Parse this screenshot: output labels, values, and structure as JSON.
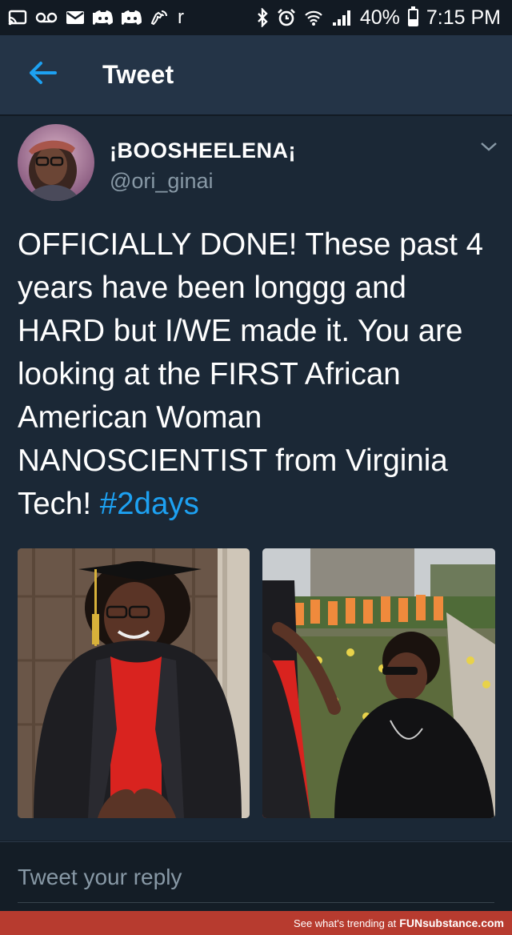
{
  "status_bar": {
    "carrier_glyph": "r",
    "battery_percent": "40%",
    "battery_level": 0.4,
    "time": "7:15 PM",
    "icons": [
      "cast-icon",
      "voicemail-icon",
      "mail-icon",
      "discord-icon",
      "discord-icon",
      "wifi-calling-icon",
      "bluetooth-icon",
      "alarm-icon",
      "wifi-icon",
      "signal-icon",
      "battery-icon"
    ]
  },
  "app_bar": {
    "back_icon": "arrow-left-icon",
    "title": "Tweet"
  },
  "tweet": {
    "display_name": "¡BOOSHEELENA¡",
    "handle": "@ori_ginai",
    "text": "OFFICIALLY DONE! These past 4 years have been longgg and HARD but I/WE made it. You are looking at  the FIRST African American Woman NANOSCIENTIST from Virginia Tech!",
    "hashtag": "#2days",
    "photos": [
      "graduate-portrait-photo",
      "family-celebration-photo"
    ]
  },
  "reply": {
    "placeholder": "Tweet your reply"
  },
  "watermark": {
    "text": "See what's trending at",
    "brand_bold": "FUN",
    "brand_rest": "substance.com"
  },
  "colors": {
    "background": "#141d26",
    "card": "#1b2836",
    "app_bar": "#243447",
    "accent": "#1da1f2",
    "secondary_text": "#8899a6"
  }
}
